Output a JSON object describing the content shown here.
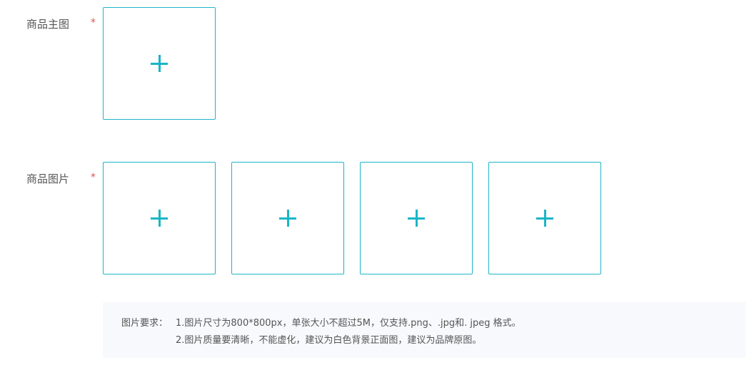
{
  "main_image": {
    "label": "商品主图",
    "required_mark": "*"
  },
  "product_images": {
    "label": "商品图片",
    "required_mark": "*",
    "slots": 4
  },
  "notes": {
    "title": "图片要求：",
    "line1": "1.图片尺寸为800*800px，单张大小不超过5M，仅支持.png、.jpg和. jpeg 格式。",
    "line2": "2.图片质量要清晰，不能虚化，建议为白色背景正面图，建议为品牌原图。"
  },
  "colors": {
    "accent": "#1fb4c8",
    "required": "#e0534e",
    "notes_background": "#f8f9fc"
  },
  "icons": {
    "upload": "plus-icon"
  }
}
